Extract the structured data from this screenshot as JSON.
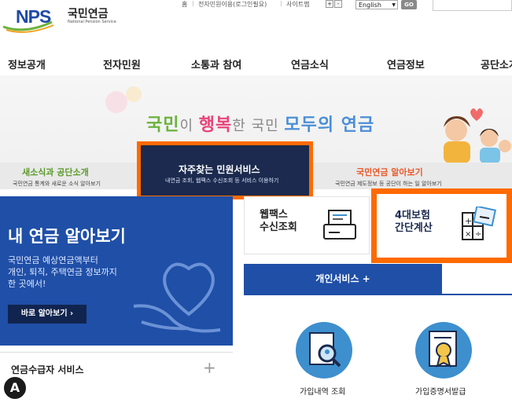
{
  "header": {
    "logo_text": "NPS",
    "logo_kr": "국민연금",
    "logo_en": "National Pension Service",
    "util_links": [
      "홈",
      "전자민원이용(로그인필요)",
      "사이트맵"
    ],
    "zoom_in": "+",
    "zoom_out": "-",
    "language_selected": "English",
    "go_label": "GO"
  },
  "gnb": {
    "items": [
      "정보공개",
      "전자민원",
      "소통과 참여",
      "연금소식",
      "연금정보",
      "공단소개"
    ]
  },
  "banner": {
    "slogan_parts": [
      "국민",
      "이 ",
      "행복",
      "한 ",
      "국민 ",
      "모두의 연금"
    ],
    "tabs": [
      {
        "title": "새소식과 공단소개",
        "sub": "국민연금 통계와 새로운 소식 알아보기"
      },
      {
        "title": "자주찾는 민원서비스",
        "sub": "내연금 조회, 웹팩스 수신조회 등 서비스 이용하기"
      },
      {
        "title": "국민연금 알아보기",
        "sub": "국민연금 제도정보 등 공단이 하는 일 알아보기"
      }
    ]
  },
  "my_pension": {
    "title": "내 연금 알아보기",
    "desc_lines": [
      "국민연금 예상연금액부터",
      "개인, 퇴직, 주택연금 정보까지",
      "한 곳에서!"
    ],
    "button": "바로 알아보기 ›"
  },
  "recipient_service": {
    "title": "연금수급자 서비스",
    "toggle": "+"
  },
  "cards": {
    "fax": {
      "line1": "웹팩스",
      "line2": "수신조회"
    },
    "insurance": {
      "line1": "4대보험",
      "line2": "간단계산"
    }
  },
  "personal_service": {
    "tab": "개인서비스 +",
    "items": [
      "가입내역 조회",
      "가입증명서발급"
    ]
  },
  "accessibility": {
    "label": "A"
  },
  "colors": {
    "brand_blue": "#1f4fa7",
    "navy": "#1b2a4e",
    "highlight": "#ff6a00",
    "green": "#6bb33d",
    "pink": "#e8457a"
  }
}
